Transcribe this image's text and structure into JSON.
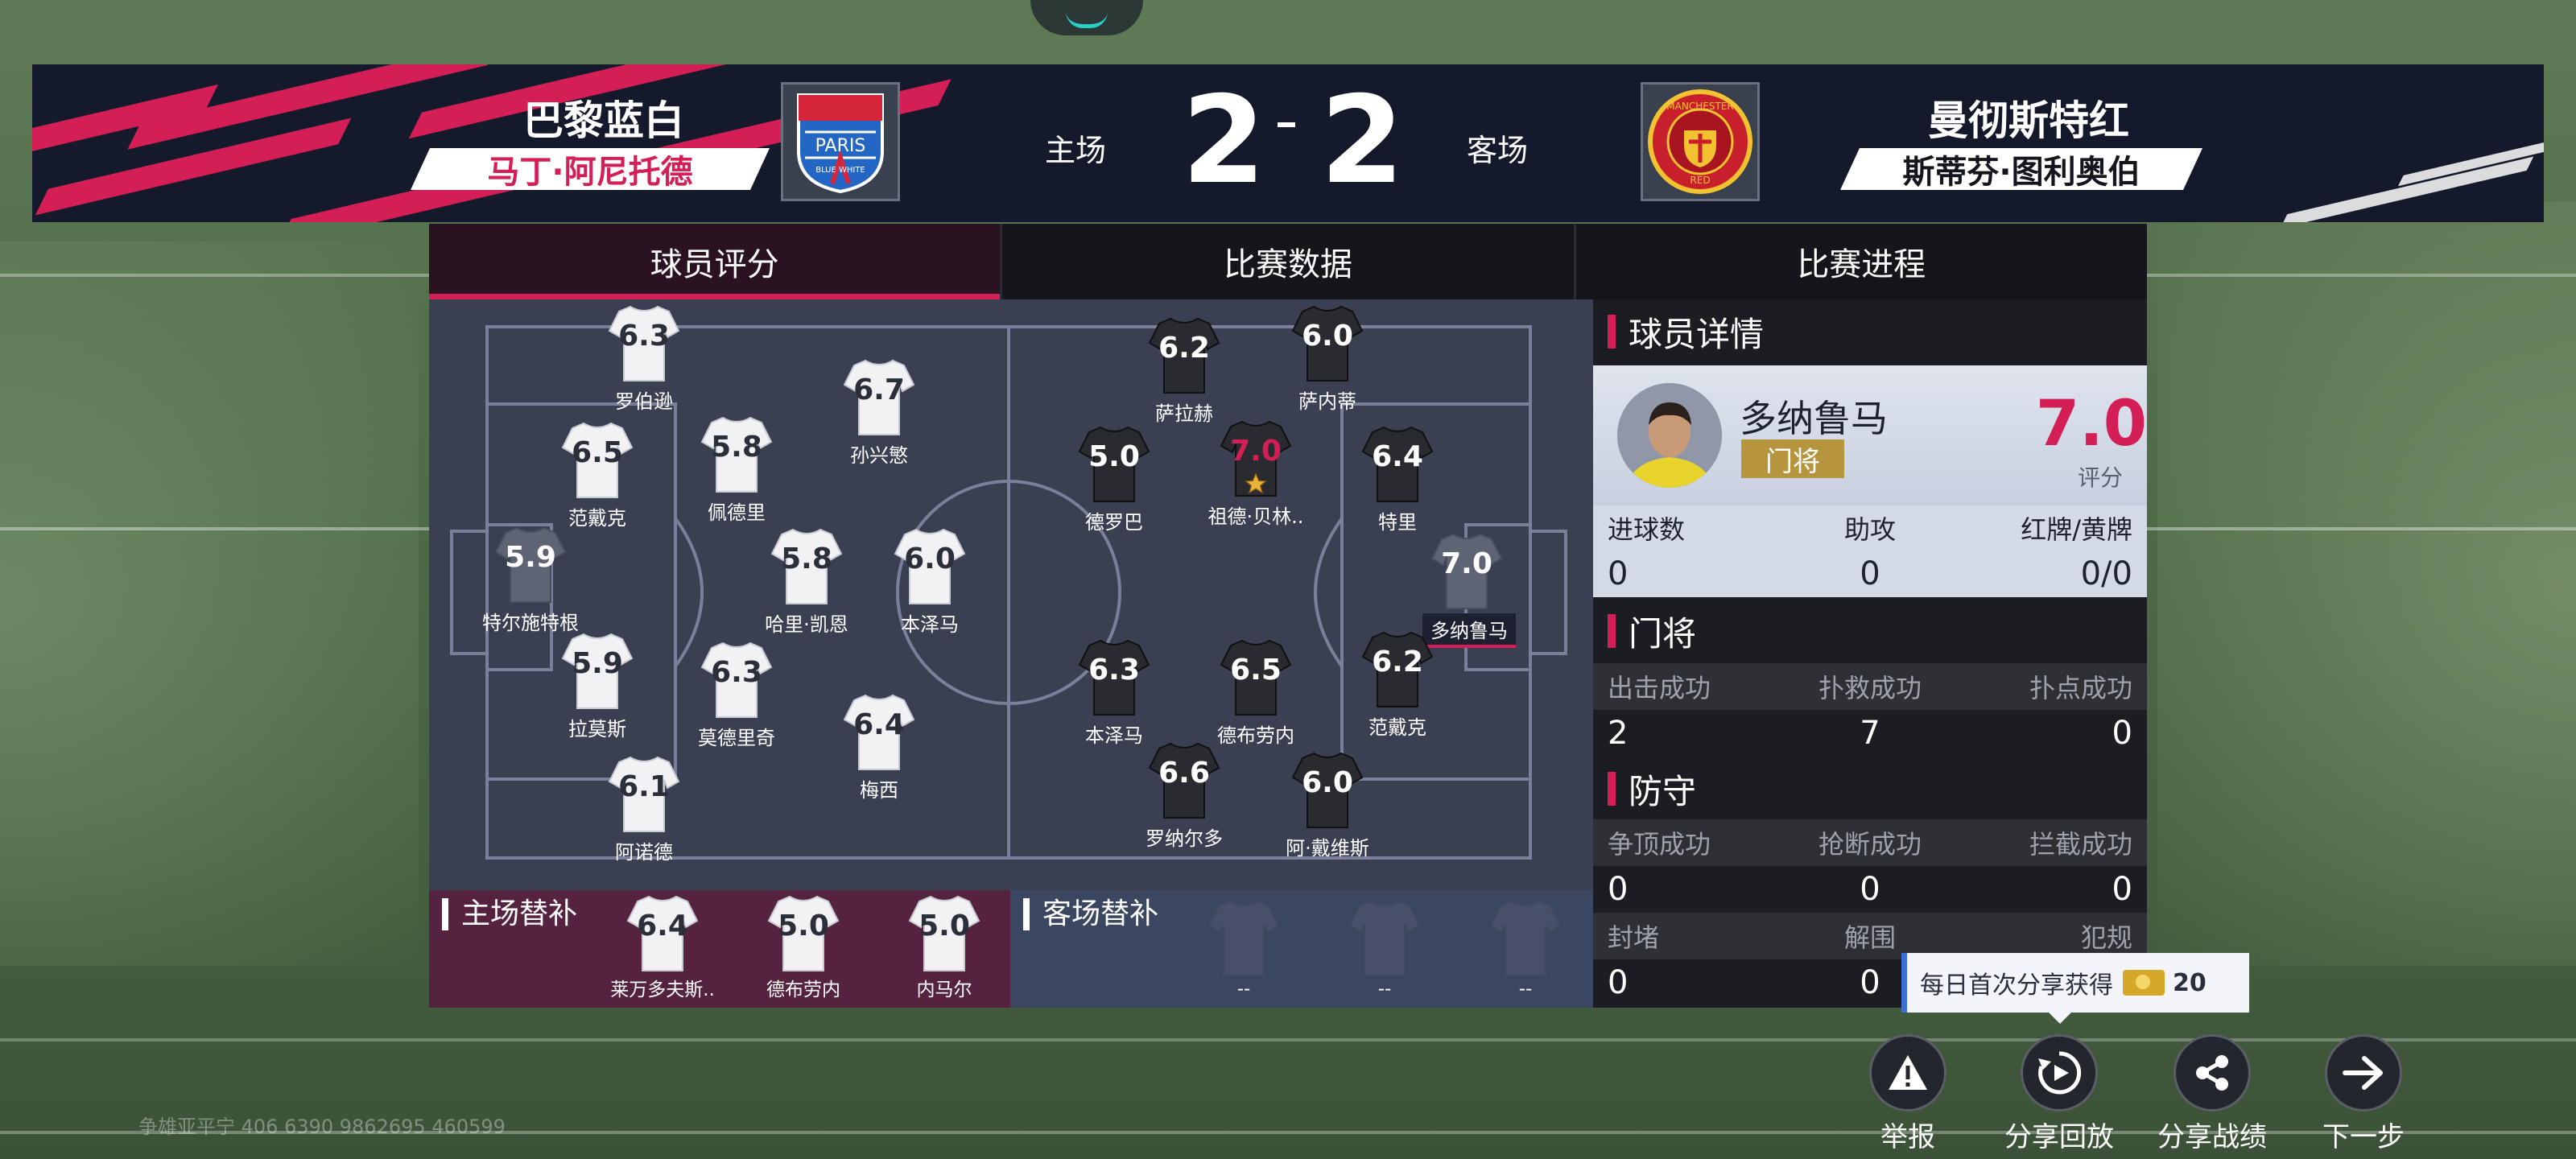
{
  "colors": {
    "accent": "#d41f56",
    "panel": "#1c1d23",
    "pitch": "#3a3f52",
    "gold": "#b6953e"
  },
  "home": {
    "name": "巴黎蓝白",
    "coach": "马丁·阿尼托德",
    "venue_label": "主场",
    "score": "2",
    "crest_text": "PARIS",
    "crest_sub": "BLUE WHITE"
  },
  "away": {
    "name": "曼彻斯特红",
    "coach": "斯蒂芬·图利奥伯",
    "venue_label": "客场",
    "score": "2",
    "crest_text": "MANCHESTER",
    "crest_sub": "RED"
  },
  "tabs": [
    "球员评分",
    "比赛数据",
    "比赛进程"
  ],
  "home_players": [
    {
      "rating": "6.3",
      "name": "罗伯逊"
    },
    {
      "rating": "6.7",
      "name": "孙兴慜"
    },
    {
      "rating": "6.5",
      "name": "范戴克"
    },
    {
      "rating": "5.8",
      "name": "佩德里"
    },
    {
      "rating": "5.9",
      "name": "特尔施特根"
    },
    {
      "rating": "5.8",
      "name": "哈里·凯恩"
    },
    {
      "rating": "6.0",
      "name": "本泽马"
    },
    {
      "rating": "5.9",
      "name": "拉莫斯"
    },
    {
      "rating": "6.3",
      "name": "莫德里奇"
    },
    {
      "rating": "6.4",
      "name": "梅西"
    },
    {
      "rating": "6.1",
      "name": "阿诺德"
    }
  ],
  "away_players": [
    {
      "rating": "6.2",
      "name": "萨拉赫"
    },
    {
      "rating": "6.0",
      "name": "萨内蒂"
    },
    {
      "rating": "5.0",
      "name": "德罗巴"
    },
    {
      "rating": "7.0",
      "name": "祖德·贝林.."
    },
    {
      "rating": "6.4",
      "name": "特里"
    },
    {
      "rating": "7.0",
      "name": "多纳鲁马"
    },
    {
      "rating": "6.3",
      "name": "本泽马"
    },
    {
      "rating": "6.5",
      "name": "德布劳内"
    },
    {
      "rating": "6.2",
      "name": "范戴克"
    },
    {
      "rating": "6.6",
      "name": "罗纳尔多"
    },
    {
      "rating": "6.0",
      "name": "阿·戴维斯"
    }
  ],
  "subs": {
    "home_title": "主场替补",
    "away_title": "客场替补",
    "home": [
      {
        "rating": "6.4",
        "name": "莱万多夫斯.."
      },
      {
        "rating": "5.0",
        "name": "德布劳内"
      },
      {
        "rating": "5.0",
        "name": "内马尔"
      }
    ],
    "away": [
      {
        "name": "--"
      },
      {
        "name": "--"
      },
      {
        "name": "--"
      }
    ]
  },
  "detail": {
    "title": "球员详情",
    "player_name": "多纳鲁马",
    "position": "门将",
    "rating": "7.0",
    "rating_label": "评分",
    "general_labels": [
      "进球数",
      "助攻",
      "红牌/黄牌"
    ],
    "general_values": [
      "0",
      "0",
      "0/0"
    ],
    "gk_title": "门将",
    "gk_labels": [
      "出击成功",
      "扑救成功",
      "扑点成功"
    ],
    "gk_values": [
      "2",
      "7",
      "0"
    ],
    "def_title": "防守",
    "def_labels": [
      "争顶成功",
      "抢断成功",
      "拦截成功"
    ],
    "def_values": [
      "0",
      "0",
      "0"
    ],
    "misc_labels": [
      "封堵",
      "解围",
      "犯规"
    ],
    "misc_values": [
      "0",
      "0",
      ""
    ]
  },
  "tooltip": {
    "text": "每日首次分享获得",
    "amount": "20"
  },
  "buttons": [
    {
      "label": "举报",
      "icon": "warning-icon"
    },
    {
      "label": "分享回放",
      "icon": "replay-icon"
    },
    {
      "label": "分享战绩",
      "icon": "share-icon"
    },
    {
      "label": "下一步",
      "icon": "arrow-right-icon"
    }
  ],
  "watermark": "争雄亚平宁 406 6390 9862695 460599"
}
